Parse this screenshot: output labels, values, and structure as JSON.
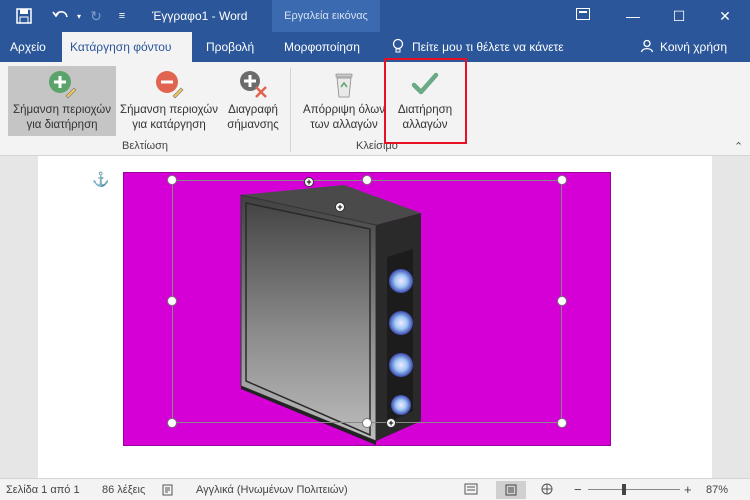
{
  "titlebar": {
    "doc_title": "Έγγραφο1 - Word",
    "context_label": "Εργαλεία εικόνας"
  },
  "tabs": [
    {
      "label": "Αρχείο"
    },
    {
      "label": "Κατάργηση φόντου"
    },
    {
      "label": "Προβολή"
    },
    {
      "label": "Μορφοποίηση"
    }
  ],
  "tell_me": "Πείτε μου τι θέλετε να κάνετε",
  "share": "Κοινή χρήση",
  "ribbon": {
    "mark_keep_1": "Σήμανση περιοχών",
    "mark_keep_2": "για διατήρηση",
    "mark_remove_1": "Σήμανση περιοχών",
    "mark_remove_2": "για κατάργηση",
    "delete_mark_1": "Διαγραφή",
    "delete_mark_2": "σήμανσης",
    "discard_1": "Απόρριψη όλων",
    "discard_2": "των αλλαγών",
    "keep_1": "Διατήρηση",
    "keep_2": "αλλαγών",
    "group_refine": "Βελτίωση",
    "group_close": "Κλείσιμο"
  },
  "status": {
    "page": "Σελίδα 1 από 1",
    "words": "86 λέξεις",
    "language": "Αγγλικά (Ηνωμένων Πολιτειών)",
    "zoom_minus": "−",
    "zoom_plus": "+",
    "zoom": "87%"
  },
  "colors": {
    "accent": "#2b579a",
    "image_background": "#d400d6",
    "highlight": "#e81123"
  }
}
